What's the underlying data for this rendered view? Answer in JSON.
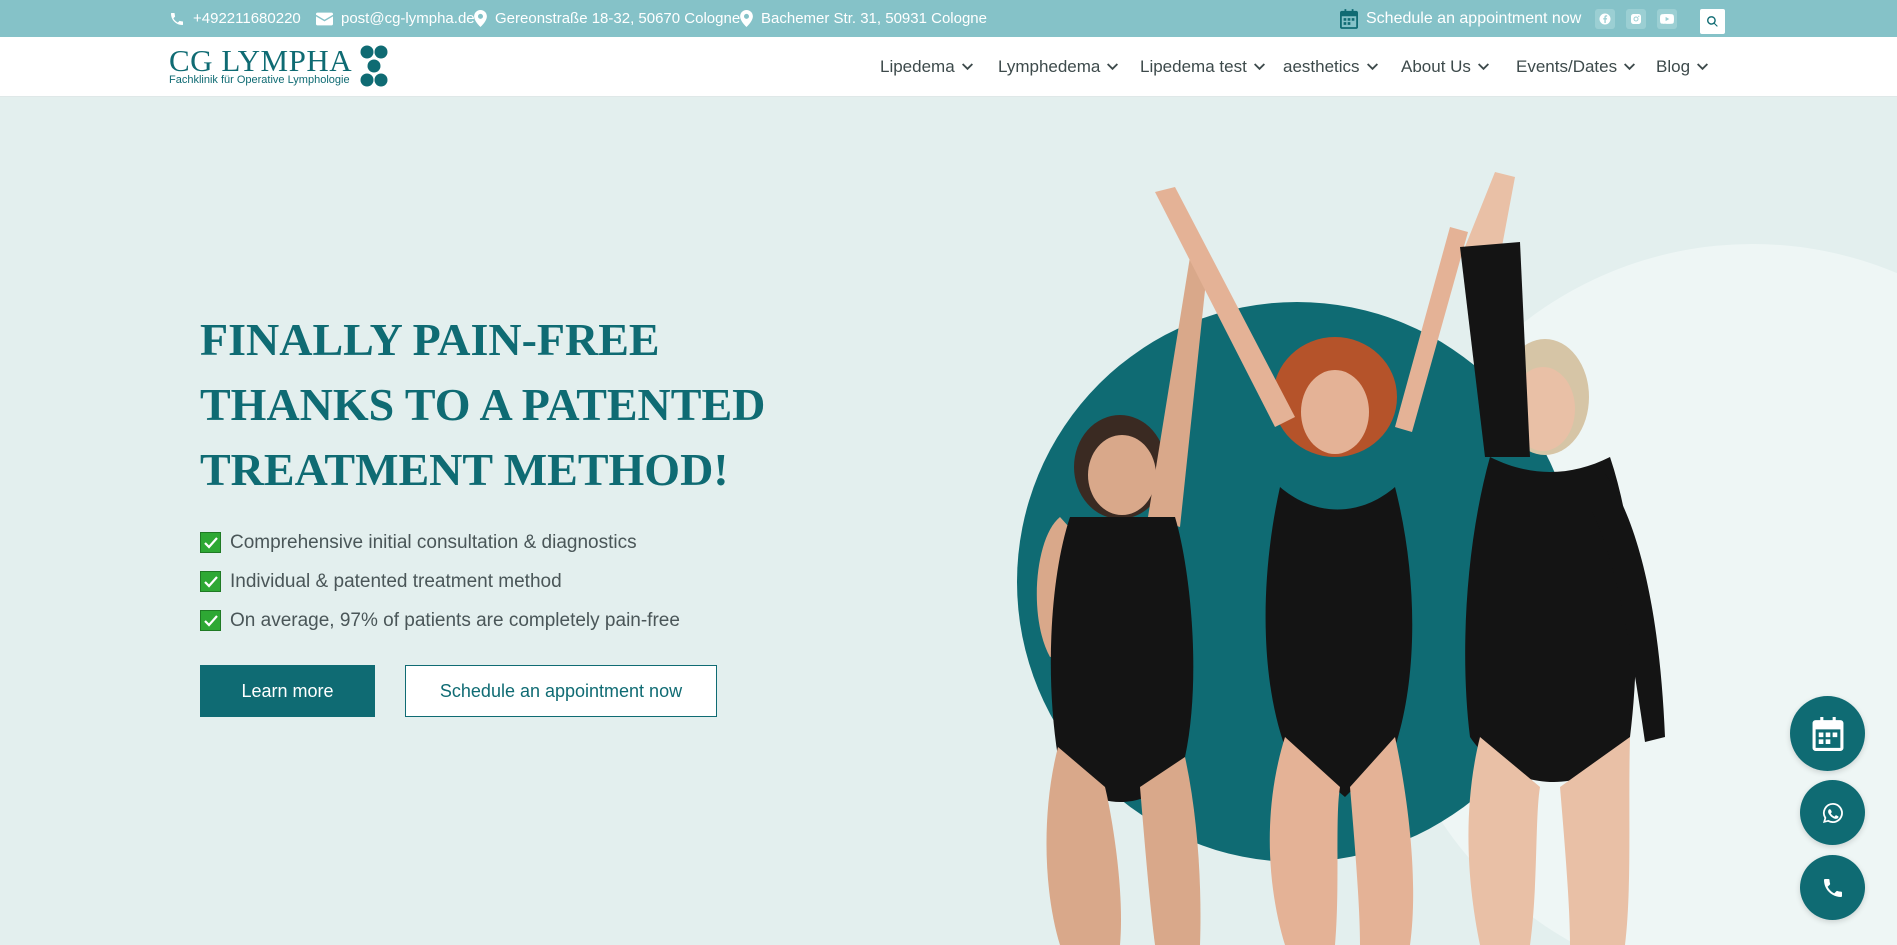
{
  "topbar": {
    "phone": "+492211680220",
    "email": "post@cg-lympha.de",
    "address_1": "Gereonstraße 18-32, 50670 Cologne",
    "address_2": "Bachemer Str. 31, 50931 Cologne",
    "appointment": "Schedule an appointment now",
    "socials": [
      "facebook-icon",
      "instagram-icon",
      "youtube-icon"
    ]
  },
  "header": {
    "logo_text": "CG LYMPHA",
    "logo_subtitle": "Fachklinik für Operative Lymphologie",
    "nav": [
      {
        "label": "Lipedema"
      },
      {
        "label": "Lymphedema"
      },
      {
        "label": "Lipedema test"
      },
      {
        "label": "aesthetics"
      },
      {
        "label": "About Us"
      },
      {
        "label": "Events/Dates"
      },
      {
        "label": "Blog"
      }
    ]
  },
  "hero": {
    "title": "FINALLY PAIN-FREE THANKS TO A PATENTED TREATMENT METHOD!",
    "checklist": [
      "Comprehensive initial consultation & diagnostics",
      "Individual & patented treatment method",
      "On average, 97% of patients are completely pain-free"
    ],
    "primary_button": "Learn more",
    "secondary_button": "Schedule an appointment now"
  },
  "floating": [
    "calendar-icon",
    "whatsapp-icon",
    "phone-icon"
  ],
  "colors": {
    "brand": "#0f6b73",
    "topbar": "#85c2c8",
    "background": "#e3efee",
    "check": "#2ea834"
  }
}
